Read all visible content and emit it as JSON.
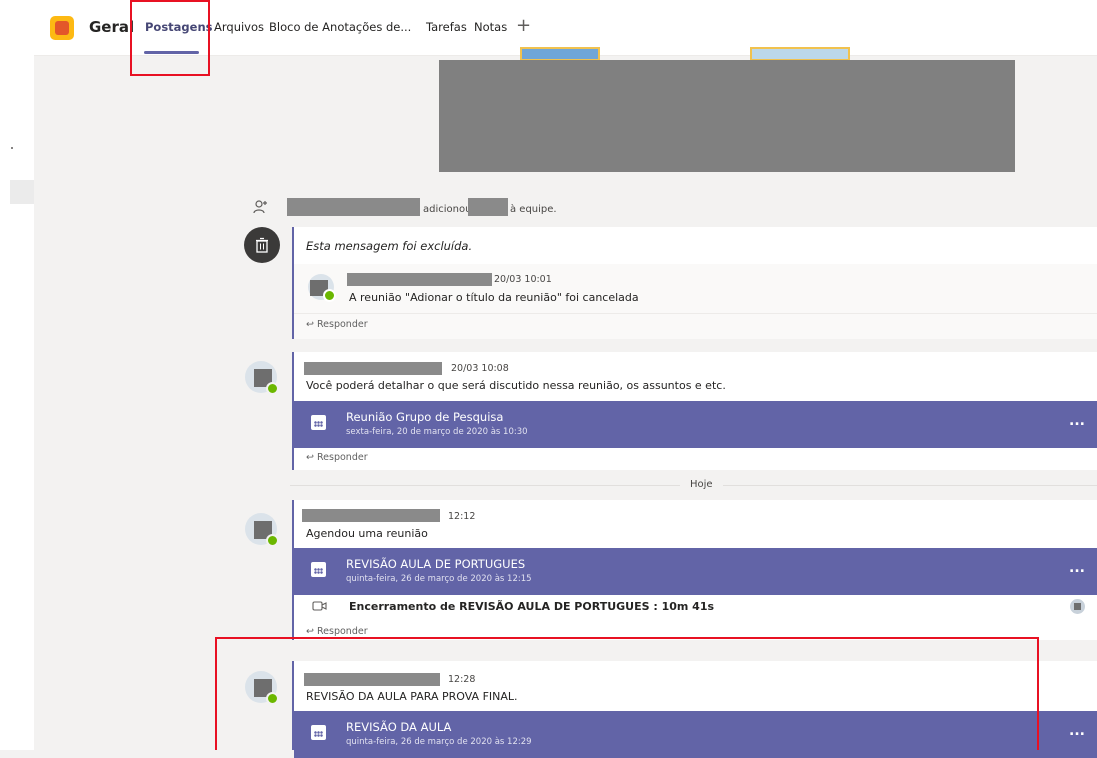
{
  "header": {
    "channel_name": "Geral",
    "tabs": [
      "Postagens",
      "Arquivos",
      "Bloco de Anotações de...",
      "Tarefas",
      "Notas"
    ],
    "add_tab": "+"
  },
  "system_message": {
    "text_added": "adicionou",
    "text_team": "à equipe."
  },
  "deleted_thread": {
    "deleted_text": "Esta mensagem foi excluída.",
    "reply_time": "20/03 10:01",
    "reply_text": "A reunião \"Adionar o título da reunião\" foi cancelada",
    "reply_label": "Responder"
  },
  "post1": {
    "time": "20/03 10:08",
    "text": "Você poderá detalhar o que será discutido nessa reunião, os assuntos  e etc.",
    "meeting_title": "Reunião Grupo de Pesquisa",
    "meeting_date": "sexta-feira, 20 de março de 2020 às 10:30",
    "more": "...",
    "reply_label": "Responder"
  },
  "day_separator": "Hoje",
  "post2": {
    "time": "12:12",
    "text": "Agendou uma reunião",
    "meeting_title": "REVISÃO AULA DE PORTUGUES",
    "meeting_date": "quinta-feira, 26 de março de 2020 às 12:15",
    "more": "...",
    "ended_text": "Encerramento de REVISÃO AULA DE PORTUGUES : 10m 41s",
    "reply_label": "Responder"
  },
  "post3": {
    "time": "12:28",
    "text": "REVISÃO DA AULA PARA PROVA FINAL.",
    "meeting_title": "REVISÃO DA AULA",
    "meeting_date": "quinta-feira, 26 de março de 2020 às 12:29",
    "more": "..."
  },
  "colors": {
    "accent": "#6264a7",
    "highlight_box": "#e81123",
    "presence": "#6bb700"
  }
}
